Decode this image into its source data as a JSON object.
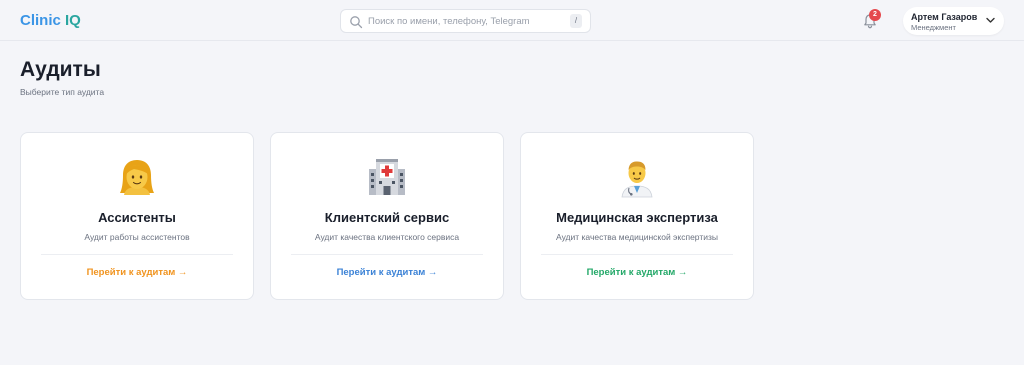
{
  "header": {
    "logo_part1": "Clinic",
    "logo_part2": " IQ",
    "search_placeholder": "Поиск по имени, телефону, Telegram",
    "search_shortcut": "/",
    "notifications_count": "2",
    "user_name": "Артем Газаров",
    "user_role": "Менеджмент"
  },
  "page": {
    "title": "Аудиты",
    "subtitle": "Выберите тип аудита"
  },
  "cards": [
    {
      "icon": "woman-emoji-icon",
      "title": "Ассистенты",
      "description": "Аудит работы ассистентов",
      "link": "Перейти к аудитам →",
      "link_color": "#f0931e"
    },
    {
      "icon": "hospital-emoji-icon",
      "title": "Клиентский сервис",
      "description": "Аудит качества клиентского сервиса",
      "link": "Перейти к аудитам →",
      "link_color": "#3b82d6"
    },
    {
      "icon": "doctor-emoji-icon",
      "title": "Медицинская экспертиза",
      "description": "Аудит качества медицинской экспертизы",
      "link": "Перейти к аудитам →",
      "link_color": "#23a868"
    }
  ],
  "colors": {
    "background": "#f4f5f9",
    "badge": "#e5484d",
    "logo_blue": "#3b95e6",
    "logo_teal": "#2aa6a0"
  }
}
